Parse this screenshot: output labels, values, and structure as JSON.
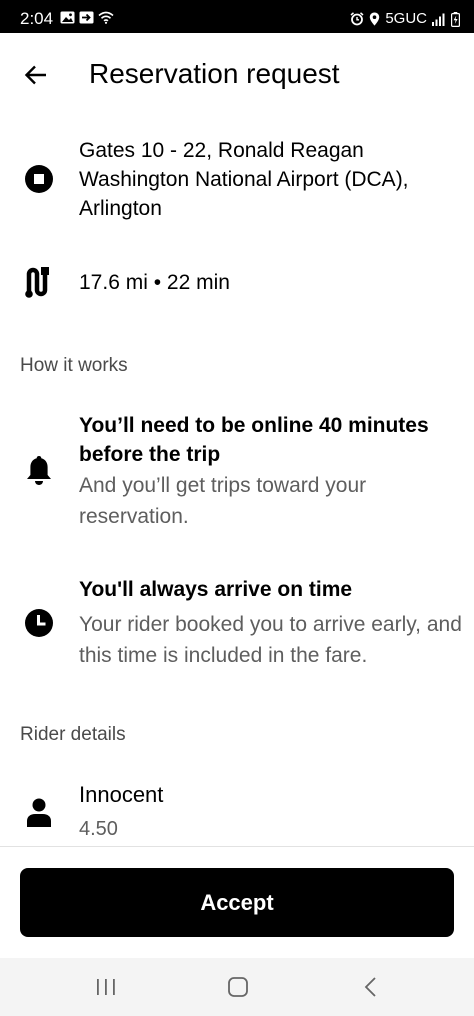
{
  "status_bar": {
    "time": "2:04",
    "network": "5GUC"
  },
  "header": {
    "title": "Reservation request"
  },
  "trip": {
    "destination": "Gates 10 - 22, Ronald Reagan Washington National Airport (DCA), Arlington",
    "distance_duration": "17.6 mi • 22 min"
  },
  "how_it_works": {
    "label": "How it works",
    "items": [
      {
        "title": "You’ll need to be online 40 minutes before the trip",
        "subtitle": "And you’ll get trips toward your reservation."
      },
      {
        "title": "You'll always arrive on time",
        "subtitle": "Your rider booked you to arrive early, and this time is included in the fare."
      }
    ]
  },
  "rider_details": {
    "label": "Rider details",
    "name": "Innocent",
    "rating": "4.50"
  },
  "actions": {
    "accept_label": "Accept"
  },
  "colors": {
    "primary": "#000000",
    "secondary_text": "#5e5e5e",
    "background": "#ffffff"
  }
}
